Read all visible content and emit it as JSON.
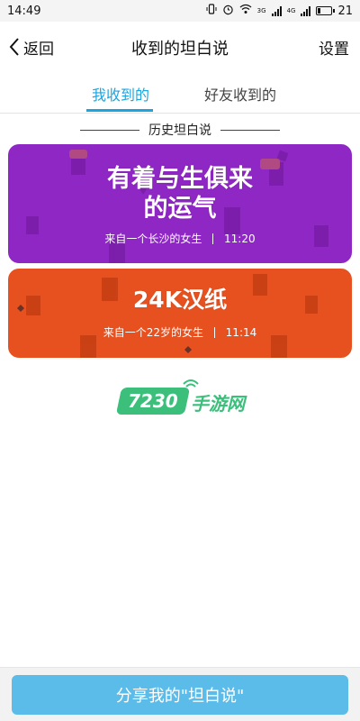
{
  "status_bar": {
    "time": "14:49",
    "network_1": "3G",
    "network_2": "4G",
    "battery": "21"
  },
  "header": {
    "back_label": "返回",
    "title": "收到的坦白说",
    "settings_label": "设置"
  },
  "tabs": [
    {
      "label": "我收到的",
      "active": true
    },
    {
      "label": "好友收到的",
      "active": false
    }
  ],
  "section": {
    "label": "历史坦白说"
  },
  "cards": [
    {
      "title_line_1": "有着与生俱来",
      "title_line_2": "的运气",
      "sender": "来自一个长沙的女生",
      "time": "11:20",
      "color": "#8f27c4"
    },
    {
      "title_line_1": "24K汉纸",
      "sender": "来自一个22岁的女生",
      "time": "11:14",
      "color": "#e7511f"
    }
  ],
  "watermark": {
    "number": "7230",
    "text": "手游网"
  },
  "bottom": {
    "share_label": "分享我的\"坦白说\""
  },
  "colors": {
    "accent": "#1aa5e0",
    "share_button": "#5bbcea",
    "watermark": "#3bbf7b"
  }
}
